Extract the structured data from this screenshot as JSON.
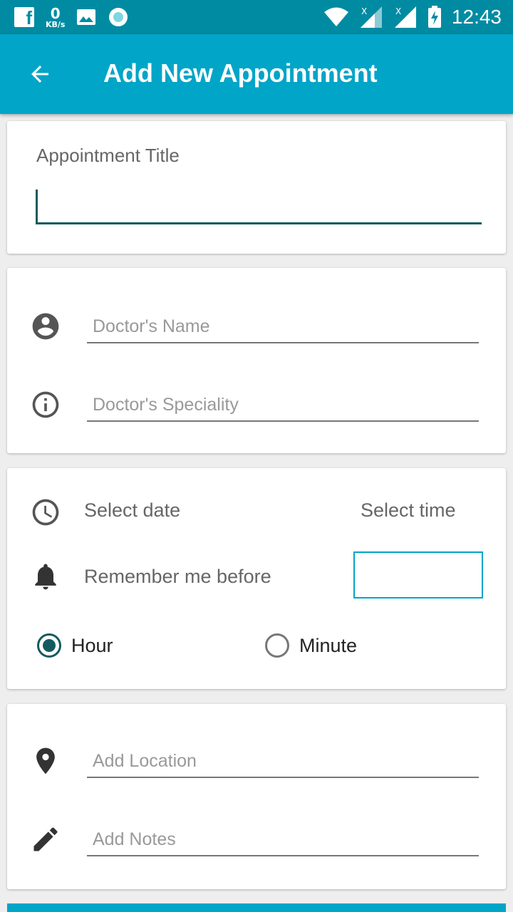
{
  "status_bar": {
    "net_speed_value": "0",
    "net_speed_unit": "KB/s",
    "time": "12:43",
    "icons": [
      "facebook-icon",
      "image-icon",
      "circle-app-icon",
      "wifi-icon",
      "signal-icon",
      "signal-icon",
      "battery-charging-icon"
    ]
  },
  "app_bar": {
    "title": "Add New Appointment",
    "back_icon": "arrow-back-icon",
    "background": "#00a5c7"
  },
  "title_card": {
    "label": "Appointment Title",
    "value": ""
  },
  "doctor_card": {
    "name_placeholder": "Doctor's Name",
    "specialty_placeholder": "Doctor's Speciality",
    "name_icon": "account-circle-icon",
    "specialty_icon": "info-icon"
  },
  "schedule_card": {
    "date_label": "Select date",
    "time_label": "Select time",
    "remind_label": "Remember me before",
    "remind_value": "",
    "clock_icon": "clock-icon",
    "bell_icon": "bell-icon",
    "units": [
      {
        "label": "Hour",
        "selected": true
      },
      {
        "label": "Minute",
        "selected": false
      }
    ]
  },
  "extra_card": {
    "location_placeholder": "Add Location",
    "notes_placeholder": "Add Notes",
    "location_icon": "location-pin-icon",
    "notes_icon": "pencil-icon"
  },
  "colors": {
    "primary": "#00a5c7",
    "status_bar": "#008ba3",
    "accent_dark": "#145a5f"
  }
}
